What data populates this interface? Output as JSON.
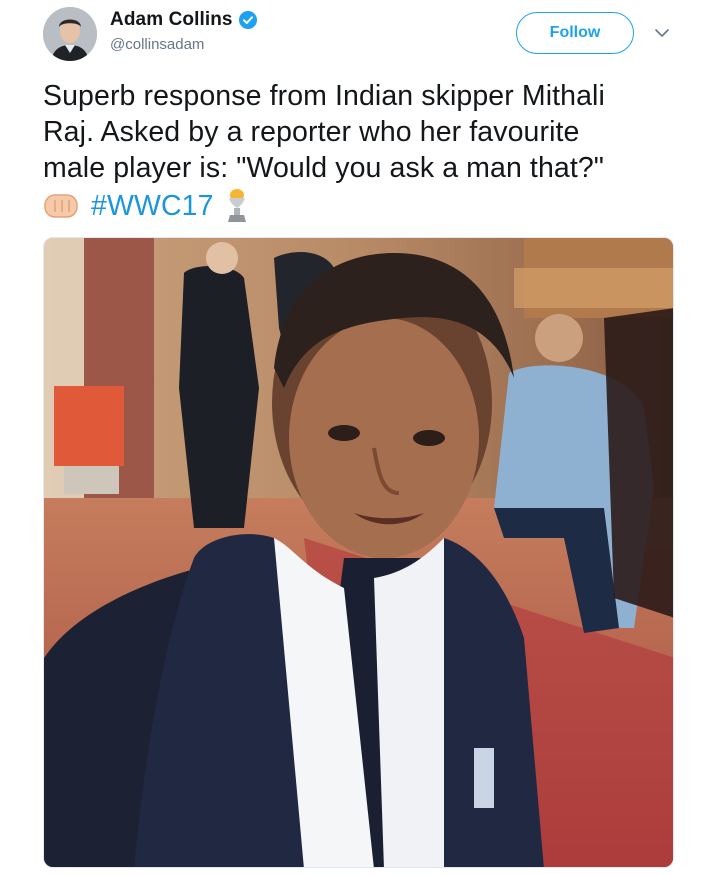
{
  "author": {
    "display_name": "Adam Collins",
    "handle": "@collinsadam",
    "verified": true
  },
  "actions": {
    "follow_label": "Follow"
  },
  "tweet": {
    "text_lines": [
      "Superb response from Indian skipper Mithali",
      "Raj. Asked by a reporter who her favourite",
      "male player is: \"Would you ask a man that?\""
    ],
    "hashtag": "#WWC17",
    "emojis": [
      "fist-emoji",
      "trophy-emoji"
    ]
  },
  "colors": {
    "accent": "#1da1f2",
    "hashtag": "#1b95e0",
    "secondary_text": "#657786"
  }
}
